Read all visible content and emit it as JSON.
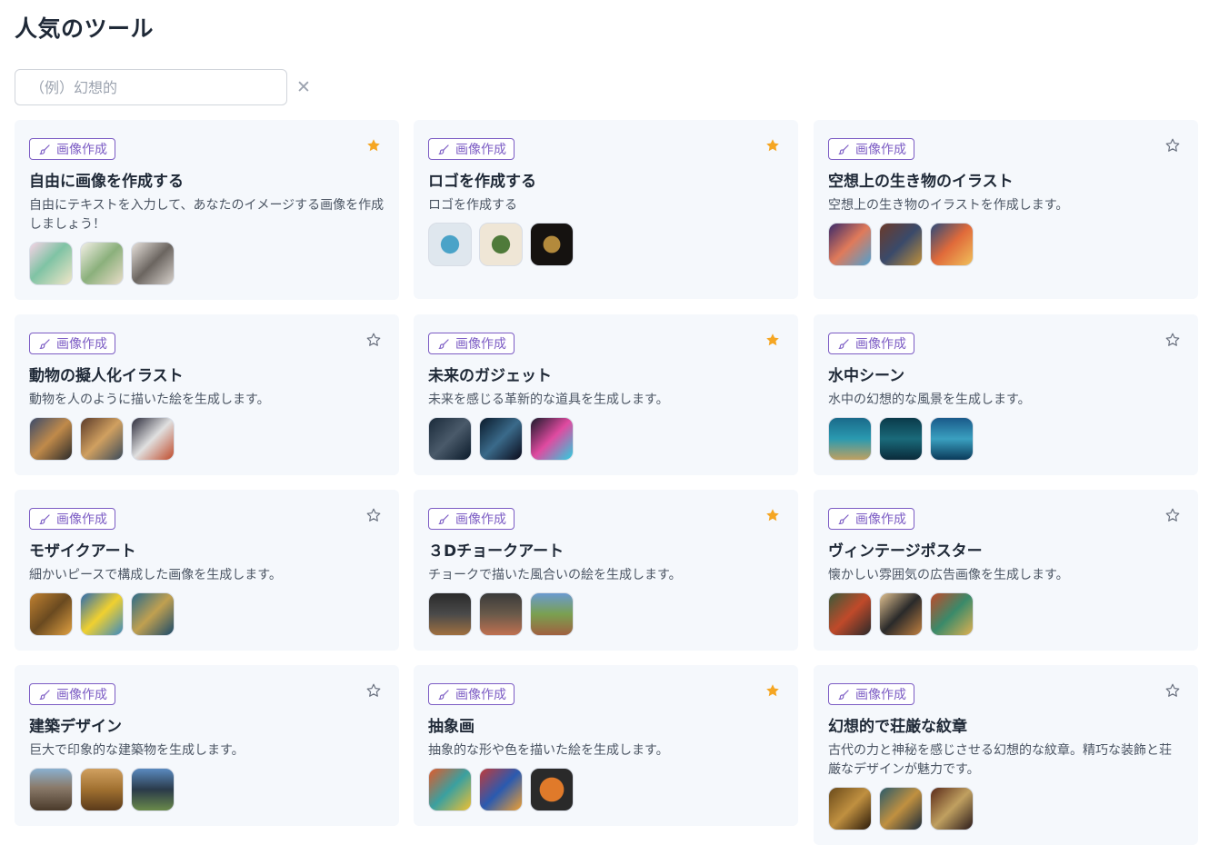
{
  "page": {
    "title": "人気のツール"
  },
  "search": {
    "placeholder": "（例）幻想的"
  },
  "colors": {
    "accent": "#7c5cc4",
    "star_active": "#f5a623",
    "star_inactive": "#6b7280",
    "card_bg": "#f5f8fc"
  },
  "cards": [
    {
      "tag": "画像作成",
      "title": "自由に画像を作成する",
      "desc": "自由にテキストを入力して、あなたのイメージする画像を作成しましょう！",
      "starred": true,
      "thumbs": [
        "linear-gradient(135deg,#f7d3e6,#7fc3a4 45%,#f1e6c8)",
        "linear-gradient(135deg,#f3efe6,#8bb07c 50%,#e9dcc8)",
        "linear-gradient(135deg,#e8e2dc,#6b6560 50%,#d8d2cc)"
      ]
    },
    {
      "tag": "画像作成",
      "title": "ロゴを作成する",
      "desc": "ロゴを作成する",
      "starred": true,
      "thumbs": [
        "radial-gradient(circle,#4aa3c8 0 30%,#dfe7ee 32%)",
        "radial-gradient(circle,#4f7a3a 0 30%,#efe6d6 32%)",
        "radial-gradient(circle,#b38a3c 0 28%,#151210 30%)"
      ]
    },
    {
      "tag": "画像作成",
      "title": "空想上の生き物のイラスト",
      "desc": "空想上の生き物のイラストを作成します。",
      "starred": false,
      "thumbs": [
        "linear-gradient(135deg,#3a2a6a,#e07a5a 50%,#4fa0d0)",
        "linear-gradient(135deg,#6b3a2a,#3a4a6a 50%,#c0903a)",
        "linear-gradient(135deg,#2a4a7a,#e06a3a 50%,#f0c05a)"
      ]
    },
    {
      "tag": "画像作成",
      "title": "動物の擬人化イラスト",
      "desc": "動物を人のように描いた絵を生成します。",
      "starred": false,
      "thumbs": [
        "linear-gradient(135deg,#3a4a6a,#c08a4a 50%,#2a2a2a)",
        "linear-gradient(135deg,#5a3a2a,#d0a060 50%,#3a4a5a)",
        "linear-gradient(135deg,#2a2a3a,#e0e0e0 50%,#c04a2a)"
      ]
    },
    {
      "tag": "画像作成",
      "title": "未来のガジェット",
      "desc": "未来を感じる革新的な道具を生成します。",
      "starred": true,
      "thumbs": [
        "linear-gradient(135deg,#1a2a3a,#4a5a6a 50%,#0a1a2a)",
        "linear-gradient(135deg,#0a1a2a,#3a6a8a 50%,#0a0a1a)",
        "linear-gradient(135deg,#1a1a2a,#e04aa0 50%,#2ad0e0)"
      ]
    },
    {
      "tag": "画像作成",
      "title": "水中シーン",
      "desc": "水中の幻想的な風景を生成します。",
      "starred": false,
      "thumbs": [
        "linear-gradient(180deg,#1a6a8a,#2a9ab0 50%,#c0a060)",
        "linear-gradient(180deg,#0a3a4a,#1a6a7a 50%,#0a2a3a)",
        "linear-gradient(180deg,#1a5a8a,#3aa0c0 50%,#0a3a5a)"
      ]
    },
    {
      "tag": "画像作成",
      "title": "モザイクアート",
      "desc": "細かいピースで構成した画像を生成します。",
      "starred": false,
      "thumbs": [
        "linear-gradient(135deg,#c08030,#6a4a20 50%,#e0a040)",
        "linear-gradient(135deg,#2a6ab0,#f0d030 50%,#3a8ac0)",
        "linear-gradient(135deg,#2a6a8a,#c0a050 50%,#1a4a6a)"
      ]
    },
    {
      "tag": "画像作成",
      "title": "３Dチョークアート",
      "desc": "チョークで描いた風合いの絵を生成します。",
      "starred": true,
      "thumbs": [
        "linear-gradient(180deg,#2a2a2a,#4a4a4a 50%,#a07040)",
        "linear-gradient(180deg,#3a3a3a,#6a5a4a 50%,#c07050)",
        "linear-gradient(180deg,#6a9ad0,#7aa050 50%,#a06040)"
      ]
    },
    {
      "tag": "画像作成",
      "title": "ヴィンテージポスター",
      "desc": "懐かしい雰囲気の広告画像を生成します。",
      "starred": false,
      "thumbs": [
        "linear-gradient(135deg,#3a5a3a,#c04a2a 50%,#2a2a2a)",
        "linear-gradient(135deg,#e0c090,#2a2a2a 50%,#c08040)",
        "linear-gradient(135deg,#c04a2a,#3a8a6a 50%,#e0b050)"
      ]
    },
    {
      "tag": "画像作成",
      "title": "建築デザイン",
      "desc": "巨大で印象的な建築物を生成します。",
      "starred": false,
      "thumbs": [
        "linear-gradient(180deg,#8ab0d0,#8a7a6a 45%,#4a3a2a)",
        "linear-gradient(180deg,#d0a060,#a07030 50%,#5a3a1a)",
        "linear-gradient(180deg,#5a8ac0,#2a3a4a 50%,#6a8a4a)"
      ]
    },
    {
      "tag": "画像作成",
      "title": "抽象画",
      "desc": "抽象的な形や色を描いた絵を生成します。",
      "starred": true,
      "thumbs": [
        "linear-gradient(135deg,#e05a2a,#3aa0a0 50%,#f0c030)",
        "linear-gradient(135deg,#c03a3a,#2a5ab0 50%,#f0a030)",
        "radial-gradient(circle,#e07a2a 0 40%,#2a2a2a 42%)"
      ]
    },
    {
      "tag": "画像作成",
      "title": "幻想的で荘厳な紋章",
      "desc": "古代の力と神秘を感じさせる幻想的な紋章。精巧な装飾と荘厳なデザインが魅力です。",
      "starred": false,
      "thumbs": [
        "linear-gradient(135deg,#6a4a1a,#c09040 50%,#2a1a0a)",
        "linear-gradient(135deg,#2a5a6a,#c09040 50%,#1a2a3a)",
        "linear-gradient(135deg,#5a2a1a,#c0a060 50%,#2a1a1a)"
      ]
    }
  ]
}
